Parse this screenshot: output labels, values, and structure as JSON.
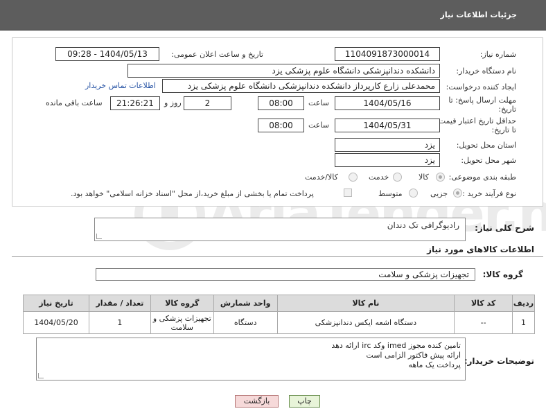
{
  "header": {
    "title": "جزئیات اطلاعات نیاز"
  },
  "fields": {
    "need_number_label": "شماره نیاز:",
    "need_number": "1104091873000014",
    "announce_label": "تاریخ و ساعت اعلان عمومی:",
    "announce_value": "1404/05/13 - 09:28",
    "buyer_org_label": "نام دستگاه خریدار:",
    "buyer_org": "دانشکده دندانپزشکی دانشگاه علوم پزشکی یزد",
    "requester_label": "ایجاد کننده درخواست:",
    "requester": "محمدعلی زارع کارپرداز دانشکده دندانپزشکی دانشگاه علوم پزشکی یزد",
    "contact_link": "اطلاعات تماس خریدار",
    "deadline_label_1": "مهلت ارسال پاسخ: تا",
    "deadline_label_2": "تاریخ:",
    "deadline_date": "1404/05/16",
    "time_label": "ساعت",
    "deadline_time": "08:00",
    "days_value": "2",
    "days_label": "روز و",
    "remaining_time": "21:26:21",
    "remaining_label": "ساعت باقی مانده",
    "validity_label_1": "حداقل تاریخ اعتبار قیمت:",
    "validity_label_2": "تا تاریخ:",
    "validity_date": "1404/05/31",
    "validity_time": "08:00",
    "province_label": "استان محل تحویل:",
    "province": "یزد",
    "city_label": "شهر محل تحویل:",
    "city": "یزد",
    "category_label": "طبقه بندی موضوعی:",
    "category_options": [
      "کالا",
      "خدمت",
      "کالا/خدمت"
    ],
    "process_label": "نوع فرآیند خرید :",
    "process_options": [
      "جزیی",
      "متوسط"
    ],
    "payment_note": "پرداخت تمام یا بخشی از مبلغ خرید،از محل \"اسناد خزانه اسلامی\" خواهد بود."
  },
  "description": {
    "label": "شرح کلی نیاز:",
    "value": "رادیوگرافی تک دندان"
  },
  "goods_section": {
    "title": "اطلاعات کالاهای مورد نیاز",
    "group_label": "گروه کالا:",
    "group_value": "تجهیزات پزشکی و سلامت"
  },
  "table": {
    "headers": [
      "ردیف",
      "کد کالا",
      "نام کالا",
      "واحد شمارش",
      "گروه کالا",
      "تعداد / مقدار",
      "تاریخ نیاز"
    ],
    "rows": [
      [
        "1",
        "--",
        "دستگاه اشعه ایکس دندانپزشکی",
        "دستگاه",
        "تجهیزات پزشکی و سلامت",
        "1",
        "1404/05/20"
      ]
    ]
  },
  "notes": {
    "label": "توضیحات خریدار:",
    "lines": [
      "تامین کنده مجوز imed وکد irc ارائه دهد",
      "ارائه پیش فاکتور الزامی است",
      "پرداخت یک ماهه"
    ]
  },
  "buttons": {
    "print": "چاپ",
    "back": "بازگشت"
  },
  "watermark": {
    "text": "AriaTender.net"
  },
  "colors": {
    "header_bg": "#5d5d5d",
    "link": "#2a56a6",
    "print_bg": "#e8f4d9",
    "back_bg": "#f6d9d9"
  }
}
